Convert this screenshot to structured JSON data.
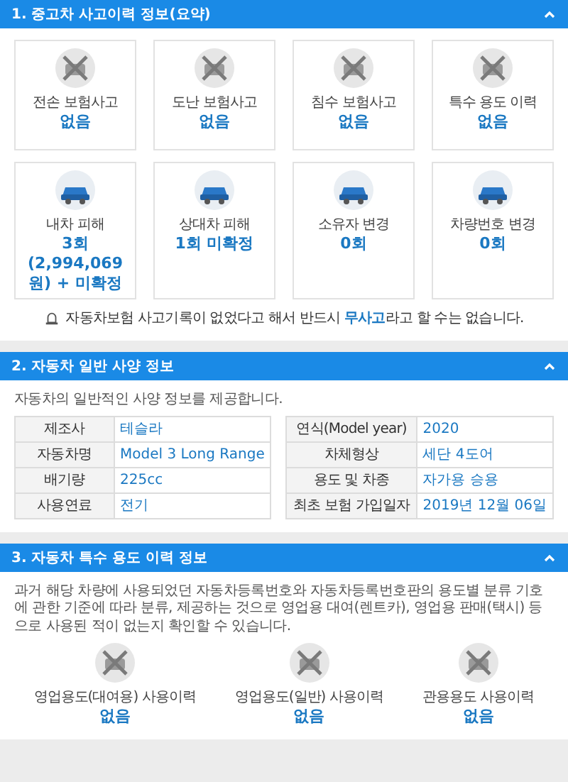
{
  "sections": [
    {
      "kind": "cards",
      "title": "1. 중고차 사고이력 정보(요약)",
      "expanded": true,
      "cards": [
        {
          "label": "전손 보험사고",
          "value": "없음",
          "crossed": true
        },
        {
          "label": "도난 보험사고",
          "value": "없음",
          "crossed": true
        },
        {
          "label": "침수 보험사고",
          "value": "없음",
          "crossed": true
        },
        {
          "label": "특수 용도 이력",
          "value": "없음",
          "crossed": true
        },
        {
          "label": "내차 피해",
          "value": "3회 (2,994,069 원) + 미확정",
          "crossed": false
        },
        {
          "label": "상대차 피해",
          "value": "1회 미확정",
          "crossed": false
        },
        {
          "label": "소유자 변경",
          "value": "0회",
          "crossed": false
        },
        {
          "label": "차량번호 변경",
          "value": "0회",
          "crossed": false
        }
      ],
      "notice": "자동차보험 사고기록이 없었다고 해서 반드시 **무사고**라고 할 수는 없습니다."
    },
    {
      "kind": "table",
      "title": "2. 자동차 일반 사양 정보",
      "expanded": true,
      "note": "자동차의 일반적인 사양 정보를 제공합니다.",
      "tables": [
        [
          {
            "label": "제조사",
            "value": "테슬라"
          },
          {
            "label": "자동차명",
            "value": "Model 3 Long Range"
          },
          {
            "label": "배기량",
            "value": "225cc"
          },
          {
            "label": "사용연료",
            "value": "전기"
          }
        ],
        [
          {
            "label": "연식(Model year)",
            "value": "2020"
          },
          {
            "label": "차체형상",
            "value": "세단 4도어"
          },
          {
            "label": "용도 및 차종",
            "value": "자가용  승용"
          },
          {
            "label": "최초 보험 가입일자",
            "value": "2019년 12월 06일"
          }
        ]
      ]
    },
    {
      "kind": "usage",
      "title": "3. 자동차 특수 용도 이력 정보",
      "expanded": true,
      "note": "과거 해당 차량에 사용되었던 자동차등록번호와 자동차등록번호판의 용도별 분류 기호에 관한 기준에 따라 분류, 제공하는 것으로 영업용 대여(렌트카), 영업용 판매(택시) 등으로 사용된 적이 없는지 확인할 수 있습니다.",
      "cards": [
        {
          "label": "영업용도(대여용) 사용이력",
          "value": "없음",
          "crossed": true
        },
        {
          "label": "영업용도(일반) 사용이력",
          "value": "없음",
          "crossed": true
        },
        {
          "label": "관용용도 사용이력",
          "value": "없음",
          "crossed": true
        }
      ]
    }
  ]
}
